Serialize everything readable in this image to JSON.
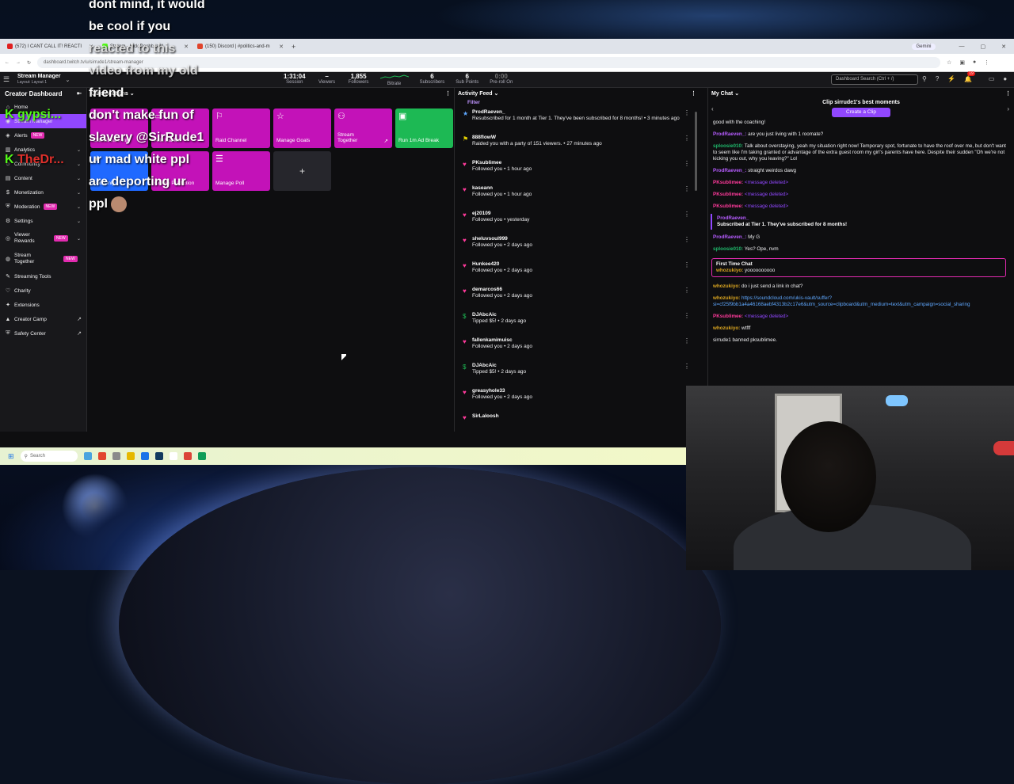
{
  "browser": {
    "tabs": [
      {
        "label": "(572) I CANT CALL IT! REACTI",
        "color": "#e02020"
      },
      {
        "label": "Stream - Kick Dashboard",
        "color": "#53fc18"
      },
      {
        "label": "(150) Discord | #politics-and-m",
        "color": "#e0442c"
      }
    ],
    "gemini": "Gemini",
    "url": "dashboard.twitch.tv/u/sirrude1/stream-manager"
  },
  "header": {
    "title": "Stream Manager",
    "subtitle": "Layout: Layout 1",
    "stats": [
      {
        "value": "1:31:04",
        "label": "Session"
      },
      {
        "value": "–",
        "label": "Viewers"
      },
      {
        "value": "1,855",
        "label": "Followers"
      },
      {
        "value": "",
        "label": "Bitrate"
      },
      {
        "value": "6",
        "label": "Subscribers"
      },
      {
        "value": "6",
        "label": "Sub Points"
      },
      {
        "value": "0:00",
        "label": "Pre-roll On"
      }
    ],
    "search_placeholder": "Dashboard Search (Ctrl + /)",
    "notif_count": "19"
  },
  "sidebar": {
    "title": "Creator Dashboard",
    "items": [
      {
        "label": "Home",
        "icon": "home-icon"
      },
      {
        "label": "Stream Manager",
        "icon": "broadcast-icon"
      },
      {
        "label": "Alerts",
        "badge": "NEW"
      },
      {
        "label": "Analytics"
      },
      {
        "label": "Community"
      },
      {
        "label": "Content"
      },
      {
        "label": "Monetization"
      },
      {
        "label": "Moderation",
        "badge": "NEW"
      },
      {
        "label": "Settings"
      },
      {
        "label": "Viewer Rewards",
        "badge": "NEW"
      },
      {
        "label": "Stream Together",
        "badge": "NEW"
      },
      {
        "label": "Streaming Tools"
      },
      {
        "label": "Charity"
      },
      {
        "label": "Extensions"
      },
      {
        "label": "Creator Camp"
      },
      {
        "label": "Safety Center"
      }
    ]
  },
  "quick_actions": {
    "title": "Quick Actions",
    "tiles": [
      {
        "label": "Edit Stream Info",
        "color": "#c312b8",
        "icon": "pencil-icon"
      },
      {
        "label": "Add Marker",
        "color": "#c312b8",
        "icon": "marker-icon"
      },
      {
        "label": "Raid Channel",
        "color": "#c312b8",
        "icon": "raid-icon"
      },
      {
        "label": "Manage Goals",
        "color": "#c312b8",
        "icon": "star-icon"
      },
      {
        "label": "Stream Together",
        "color": "#c312b8",
        "icon": "add-user-icon"
      },
      {
        "label": "Run 1m Ad Break",
        "color": "#1db954",
        "icon": "ad-icon"
      },
      {
        "label": "Sub Only",
        "color": "#1f69ff",
        "icon": "star-icon"
      },
      {
        "label": "Create Prediction",
        "color": "#c312b8",
        "icon": "prediction-icon"
      },
      {
        "label": "Manage Poll",
        "color": "#c312b8",
        "icon": "poll-icon"
      }
    ]
  },
  "activity": {
    "title": "Activity Feed",
    "filter": "Filter",
    "events": [
      {
        "user": "ProdRaeven_",
        "text": "Resubscribed for 1 month at Tier 1. They've been subscribed for 8 months! • 3 minutes ago",
        "icon": "★",
        "color": "#5fa8ff"
      },
      {
        "user": "888flowW",
        "text": "Raided you with a party of 151 viewers. • 27 minutes ago",
        "icon": "⚑",
        "color": "#e6d200"
      },
      {
        "user": "PKsublimee",
        "text": "Followed you • 1 hour ago",
        "icon": "♥",
        "color": "#ff3a9b"
      },
      {
        "user": "kaseann",
        "text": "Followed you • 1 hour ago",
        "icon": "♥",
        "color": "#ff3a9b"
      },
      {
        "user": "ej20109",
        "text": "Followed you • yesterday",
        "icon": "♥",
        "color": "#ff3a9b"
      },
      {
        "user": "sheluvsoul999",
        "text": "Followed you • 2 days ago",
        "icon": "♥",
        "color": "#ff3a9b"
      },
      {
        "user": "Hunkee420",
        "text": "Followed you • 2 days ago",
        "icon": "♥",
        "color": "#ff3a9b"
      },
      {
        "user": "demarcos66",
        "text": "Followed you • 2 days ago",
        "icon": "♥",
        "color": "#ff3a9b"
      },
      {
        "user": "DJAbcAic",
        "text": "Tipped $5! • 2 days ago",
        "icon": "$",
        "color": "#1db954"
      },
      {
        "user": "fallenkamimuisc",
        "text": "Followed you • 2 days ago",
        "icon": "♥",
        "color": "#ff3a9b"
      },
      {
        "user": "DJAbcAic",
        "text": "Tipped $5! • 2 days ago",
        "icon": "$",
        "color": "#1db954"
      },
      {
        "user": "greasyhole33",
        "text": "Followed you • 2 days ago",
        "icon": "♥",
        "color": "#ff3a9b"
      },
      {
        "user": "SirLaloosh",
        "text": "",
        "icon": "♥",
        "color": "#ff3a9b"
      }
    ]
  },
  "chat": {
    "title": "My Chat",
    "clip_title": "Clip sirrude1's best moments",
    "clip_button": "Create a Clip",
    "messages": [
      {
        "user": "",
        "text": "good with the coaching!",
        "cls": ""
      },
      {
        "user": "ProdRaeven_:",
        "text": "are you just living with 1 roomate?",
        "cls": "u1"
      },
      {
        "user": "sploosie010:",
        "text": "Talk about overstaying, yeah my situation right now! Temporary spot, fortunate to have the roof over me, but don't want to seem like I'm taking granted or advantage of the extra guest room my girl's parents have here. Despite their sudden \"Oh we're not kicking you out, why you leaving?\" Lol",
        "cls": "u2"
      },
      {
        "user": "ProdRaeven_:",
        "text": "straight weirdos dawg",
        "cls": "u1"
      },
      {
        "user": "PKsublimee:",
        "text": "<message deleted>",
        "cls": "u3"
      },
      {
        "user": "PKsublimee:",
        "text": "<message deleted>",
        "cls": "u3"
      },
      {
        "user": "PKsublimee:",
        "text": "<message deleted>",
        "cls": "u3"
      }
    ],
    "sub_user": "ProdRaeven_",
    "sub_text": "Subscribed at Tier 1. They've subscribed for 8 months!",
    "messages2": [
      {
        "user": "ProdRaeven_:",
        "text": "My G",
        "cls": "u1"
      },
      {
        "user": "sploosie010:",
        "text": "Yes? Ope, nvm",
        "cls": "u2"
      }
    ],
    "first_time_label": "First Time Chat",
    "first_time_user": "whozukiyo:",
    "first_time_text": "yoooooooooo",
    "messages3": [
      {
        "user": "whozukiyo:",
        "text": "do i just send a link in chat?",
        "cls": "u5"
      },
      {
        "user": "whozukiyo:",
        "text": "https://soundcloud.com/ukis-vault/suffer?si=cf25f9bb1a4a46168aebf4313b2c17e6&utm_source=clipboard&utm_medium=text&utm_campaign=social_sharing",
        "cls": "u5",
        "link": true
      },
      {
        "user": "PKsublimee:",
        "text": "<message deleted>",
        "cls": "u3"
      },
      {
        "user": "whozukiyo:",
        "text": "wtfff",
        "cls": "u5"
      },
      {
        "user": "",
        "text": "sirrude1 banned pksublimee.",
        "cls": ""
      }
    ]
  },
  "taskbar": {
    "search": "Search"
  },
  "overlay": {
    "line1": "dont mind, it would",
    "line2": "be cool if you",
    "line3": "reacted to this",
    "line4": "video from my old",
    "line5": "friend",
    "kick_user1": "gypsi...",
    "kick_user2": "TheDr...",
    "m1": "don't make fun of",
    "m2": "slavery @SirRude1",
    "m3": "ur mad white ppl",
    "m4": "are deporting ur",
    "m5": "ppl"
  }
}
